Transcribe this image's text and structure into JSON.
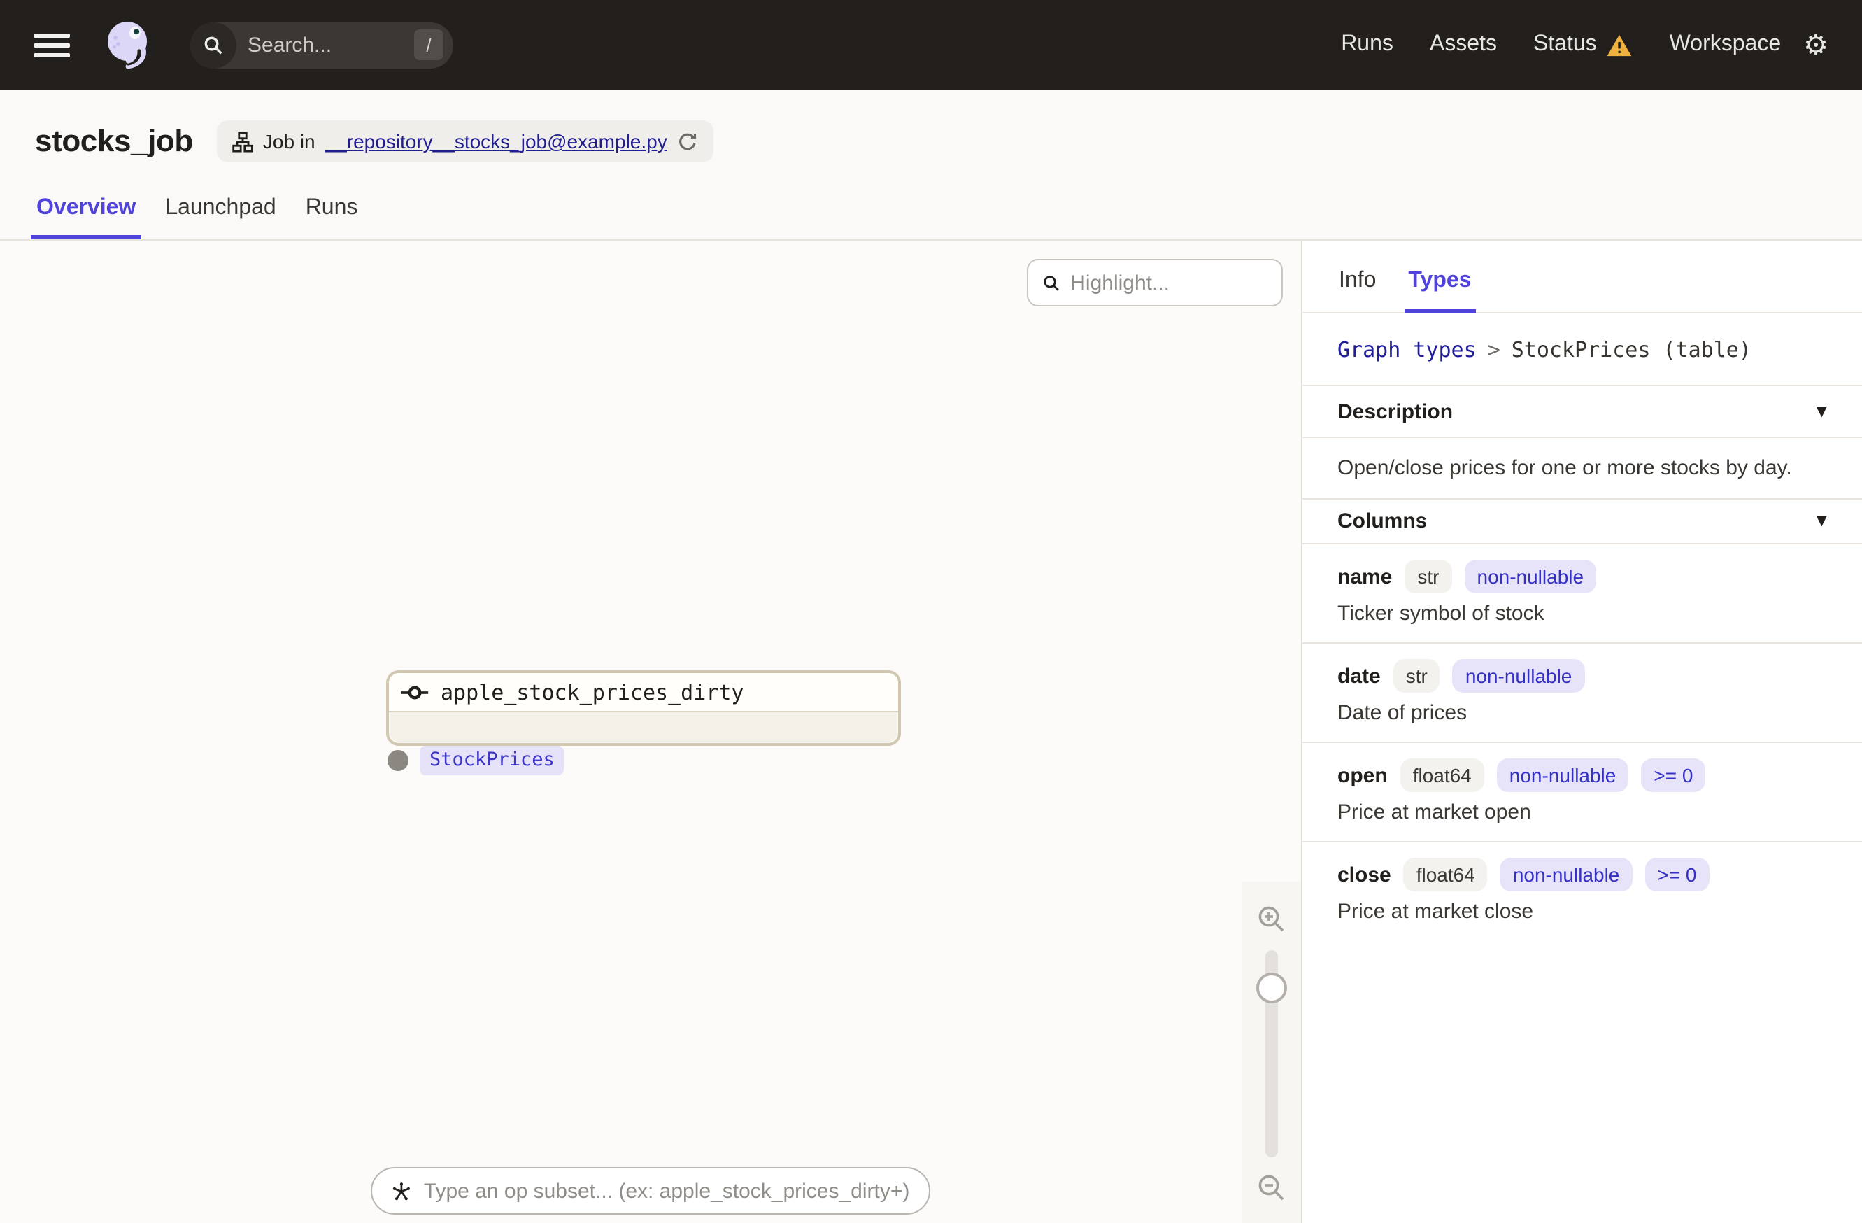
{
  "nav": {
    "search_placeholder": "Search...",
    "search_shortcut": "/",
    "items": [
      {
        "label": "Runs"
      },
      {
        "label": "Assets"
      },
      {
        "label": "Status",
        "warning": true
      },
      {
        "label": "Workspace"
      }
    ],
    "gear_icon": "gear-icon"
  },
  "header": {
    "title": "stocks_job",
    "job_badge": {
      "prefix": "Job in",
      "link": "__repository__stocks_job@example.py"
    },
    "tabs": [
      {
        "label": "Overview",
        "active": true
      },
      {
        "label": "Launchpad",
        "active": false
      },
      {
        "label": "Runs",
        "active": false
      }
    ]
  },
  "canvas": {
    "highlight_placeholder": "Highlight...",
    "node": {
      "label": "apple_stock_prices_dirty",
      "output_type": "StockPrices"
    },
    "subset_placeholder": "Type an op subset... (ex: apple_stock_prices_dirty+)"
  },
  "sidebar": {
    "tabs": [
      {
        "label": "Info",
        "active": false
      },
      {
        "label": "Types",
        "active": true
      }
    ],
    "breadcrumb": {
      "link": "Graph types",
      "separator": ">",
      "current": "StockPrices (table)"
    },
    "description": {
      "title": "Description",
      "body": "Open/close prices for one or more stocks by day."
    },
    "columns_title": "Columns",
    "columns": [
      {
        "name": "name",
        "type": "str",
        "tags": [
          "non-nullable"
        ],
        "description": "Ticker symbol of stock"
      },
      {
        "name": "date",
        "type": "str",
        "tags": [
          "non-nullable"
        ],
        "description": "Date of prices"
      },
      {
        "name": "open",
        "type": "float64",
        "tags": [
          "non-nullable",
          ">= 0"
        ],
        "description": "Price at market open"
      },
      {
        "name": "close",
        "type": "float64",
        "tags": [
          "non-nullable",
          ">= 0"
        ],
        "description": "Price at market close"
      }
    ]
  },
  "colors": {
    "accent": "#4f43dc",
    "link_navy": "#211e8f",
    "warning_amber": "#f0b23e",
    "tag_bg": "#e7e4fa",
    "tag_text": "#3531c5",
    "node_border": "#d2c8b0",
    "node_body_bg": "#f3f0e8",
    "navbar_bg": "#231f1d"
  },
  "caret_glyph": "▼"
}
